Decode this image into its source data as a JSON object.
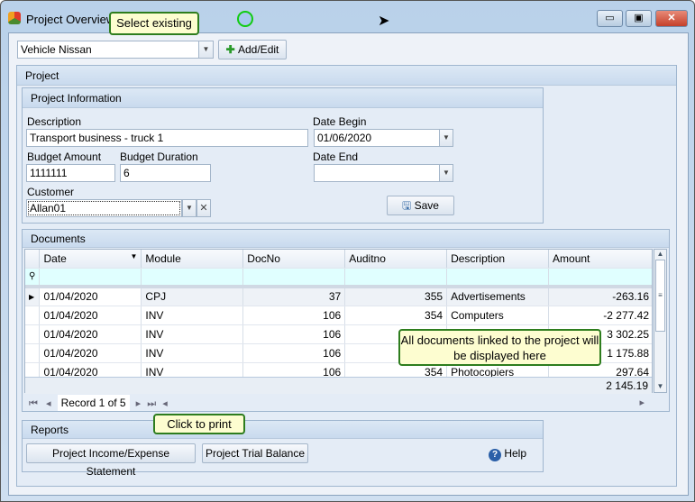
{
  "window": {
    "title": "Project Overview",
    "minimize": "▭",
    "maximize": "▣",
    "close": "✕"
  },
  "top": {
    "project_select": "Vehicle Nissan",
    "add_edit": "Add/Edit"
  },
  "callouts": {
    "select": "Select existing",
    "documents": "All documents linked to the project will be displayed here",
    "print": "Click to print"
  },
  "project_group": {
    "title": "Project"
  },
  "info": {
    "title": "Project Information",
    "description_label": "Description",
    "description": "Transport business - truck 1",
    "date_begin_label": "Date Begin",
    "date_begin": "01/06/2020",
    "budget_amount_label": "Budget Amount",
    "budget_amount": "1111111",
    "budget_duration_label": "Budget Duration",
    "budget_duration": "6",
    "date_end_label": "Date End",
    "date_end": "",
    "customer_label": "Customer",
    "customer": "Allan01",
    "save": "Save"
  },
  "documents": {
    "title": "Documents",
    "columns": [
      "Date",
      "Module",
      "DocNo",
      "Auditno",
      "Description",
      "Amount"
    ],
    "rows": [
      [
        "01/04/2020",
        "CPJ",
        "37",
        "355",
        "Advertisements",
        "-263.16"
      ],
      [
        "01/04/2020",
        "INV",
        "106",
        "354",
        "Computers",
        "-2 277.42"
      ],
      [
        "01/04/2020",
        "INV",
        "106",
        "",
        "",
        "3 302.25"
      ],
      [
        "01/04/2020",
        "INV",
        "106",
        "",
        "",
        "1 175.88"
      ],
      [
        "01/04/2020",
        "INV",
        "106",
        "354",
        "Photocopiers",
        "297.64"
      ]
    ],
    "total": "2 145.19",
    "navigator": "Record 1 of 5"
  },
  "reports": {
    "title": "Reports",
    "income_expense": "Project Income/Expense Statement",
    "trial_balance": "Project Trial Balance",
    "help": "Help"
  }
}
